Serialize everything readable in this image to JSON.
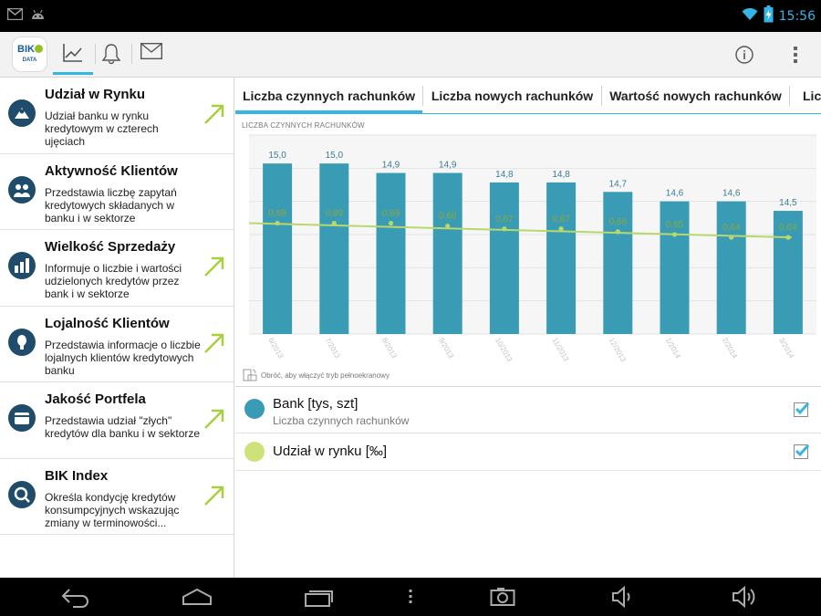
{
  "statusbar": {
    "time": "15:56",
    "icons": [
      "gmail-icon",
      "android-icon",
      "wifi-icon",
      "battery-charging-icon"
    ]
  },
  "app": {
    "logo_text": "BIK",
    "logo_sub": "DATA",
    "toolbar_tabs": [
      {
        "icon": "chart-icon",
        "active": true
      },
      {
        "icon": "bell-icon",
        "active": false
      },
      {
        "icon": "mail-icon",
        "active": false
      }
    ],
    "actions": [
      "info-icon",
      "overflow-menu-icon"
    ]
  },
  "sidebar": {
    "items": [
      {
        "title": "Udział w Rynku",
        "desc": "Udział banku w rynku kredytowym w czterech ujęciach",
        "icon": "market-share-icon",
        "arrow": true
      },
      {
        "title": "Aktywność Klientów",
        "desc": "Przedstawia liczbę zapytań kredytowych składanych w banku i w sektorze",
        "icon": "clients-icon",
        "arrow": false
      },
      {
        "title": "Wielkość Sprzedaży",
        "desc": "Informuje o liczbie i wartości udzielonych kredytów przez bank i w sektorze",
        "icon": "bar-chart-icon",
        "arrow": true
      },
      {
        "title": "Lojalność Klientów",
        "desc": "Przedstawia informacje o liczbie lojalnych klientów kredytowych banku",
        "icon": "person-icon",
        "arrow": true
      },
      {
        "title": "Jakość Portfela",
        "desc": "Przedstawia udział \"złych\" kredytów dla banku i w sektorze",
        "icon": "wallet-icon",
        "arrow": true
      },
      {
        "title": "BIK Index",
        "desc": "Określa kondycję kredytów konsumpcyjnych wskazując zmiany w terminowości...",
        "icon": "index-icon",
        "arrow": true
      }
    ]
  },
  "tabs": [
    {
      "label": "Liczba czynnych rachunków",
      "active": true
    },
    {
      "label": "Liczba nowych rachunków",
      "active": false
    },
    {
      "label": "Wartość nowych rachunków",
      "active": false
    },
    {
      "label": "Lic",
      "active": false
    }
  ],
  "chart_data": {
    "type": "bar",
    "title": "LICZBA CZYNNYCH RACHUNKÓW",
    "categories": [
      "6/2013",
      "7/2013",
      "8/2013",
      "9/2013",
      "10/2013",
      "11/2013",
      "12/2013",
      "1/2014",
      "2/2014",
      "3/2014"
    ],
    "series": [
      {
        "name": "Bank [tys, szt]",
        "type": "bar",
        "color": "#3a9bb5",
        "values": [
          15.0,
          15.0,
          14.9,
          14.9,
          14.8,
          14.8,
          14.7,
          14.6,
          14.6,
          14.5
        ],
        "labels": [
          "15,0",
          "15,0",
          "14,9",
          "14,9",
          "14,8",
          "14,8",
          "14,7",
          "14,6",
          "14,6",
          "14,5"
        ]
      },
      {
        "name": "Udział w rynku [‰]",
        "type": "line",
        "color": "#b9d86a",
        "values": [
          0.69,
          0.69,
          0.69,
          0.68,
          0.67,
          0.67,
          0.66,
          0.65,
          0.64,
          0.64
        ],
        "labels": [
          "0,69",
          "0,69",
          "0,69",
          "0,68",
          "0,67",
          "0,67",
          "0,66",
          "0,65",
          "0,64",
          "0,64"
        ]
      }
    ],
    "bar_ylim": [
      13.2,
      15.3
    ],
    "line_ylim": [
      0.3,
      1.0
    ],
    "grid": true
  },
  "chart_hint": "Obróć, aby włączyć tryb pełnoekranowy",
  "legend": [
    {
      "title": "Bank [tys, szt]",
      "subtitle": "Liczba czynnych rachunków",
      "color": "#3a9bb5",
      "checked": true
    },
    {
      "title": "Udział w rynku [‰]",
      "subtitle": "",
      "color": "#cde37a",
      "checked": true
    }
  ],
  "navbar": {
    "buttons": [
      "back-icon",
      "home-icon",
      "recents-icon",
      "menu-icon",
      "camera-icon",
      "volume-down-icon",
      "volume-up-icon"
    ]
  }
}
